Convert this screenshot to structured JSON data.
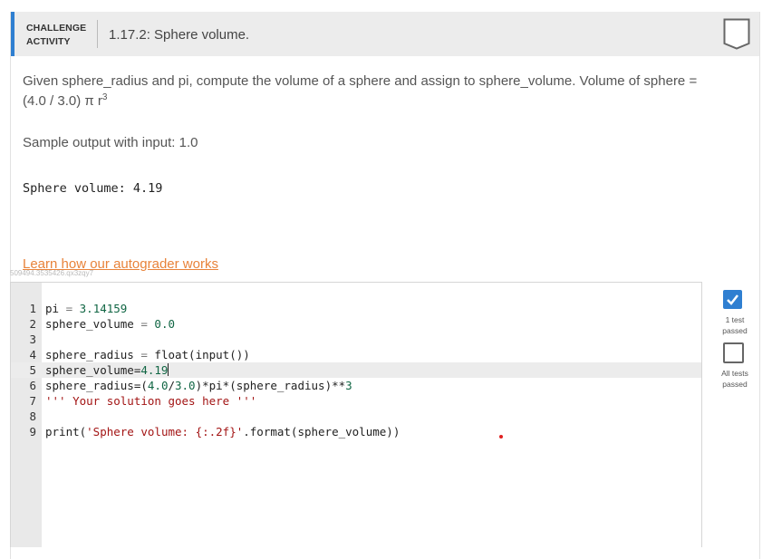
{
  "header": {
    "badge_line1": "CHALLENGE",
    "badge_line2": "ACTIVITY",
    "title": "1.17.2: Sphere volume."
  },
  "prompt": {
    "text": "Given sphere_radius and pi, compute the volume of a sphere and assign to sphere_volume. Volume of sphere = (4.0 / 3.0) π r",
    "exponent": "3"
  },
  "sample": {
    "label": "Sample output with input: 1.0",
    "output": "Sphere volume: 4.19"
  },
  "learn_link": "Learn how our autograder works",
  "hash": "509494.3535426.qx3zqy7",
  "editor": {
    "lines": [
      {
        "num": "1",
        "parts": [
          [
            "pi ",
            ""
          ],
          [
            "=",
            "op"
          ],
          [
            " ",
            ""
          ],
          [
            "3.14159",
            "num"
          ]
        ]
      },
      {
        "num": "2",
        "parts": [
          [
            "sphere_volume ",
            ""
          ],
          [
            "=",
            "op"
          ],
          [
            " ",
            ""
          ],
          [
            "0.0",
            "num"
          ]
        ]
      },
      {
        "num": "3",
        "parts": []
      },
      {
        "num": "4",
        "parts": [
          [
            "sphere_radius ",
            ""
          ],
          [
            "=",
            "op"
          ],
          [
            " float(input())",
            ""
          ]
        ]
      },
      {
        "num": "5",
        "parts": [
          [
            "sphere_volume=",
            ""
          ],
          [
            "4.19",
            "num"
          ]
        ],
        "active": true
      },
      {
        "num": "6",
        "parts": [
          [
            "sphere_radius=(",
            ""
          ],
          [
            "4.0",
            "num"
          ],
          [
            "/",
            ""
          ],
          [
            "3.0",
            "num"
          ],
          [
            ")*pi*(sphere_radius)**",
            ""
          ],
          [
            "3",
            "num"
          ]
        ]
      },
      {
        "num": "7",
        "parts": [
          [
            "''' Your solution goes here '''",
            "str"
          ]
        ]
      },
      {
        "num": "8",
        "parts": []
      },
      {
        "num": "9",
        "parts": [
          [
            "print(",
            ""
          ],
          [
            "'Sphere volume: {:.2f}'",
            "str"
          ],
          [
            ".format(sphere_volume))",
            ""
          ]
        ]
      }
    ]
  },
  "tests": {
    "test1_label": "1 test passed",
    "all_label": "All tests passed"
  },
  "colors": {
    "accent": "#2f7fd1",
    "link": "#e8833a"
  }
}
